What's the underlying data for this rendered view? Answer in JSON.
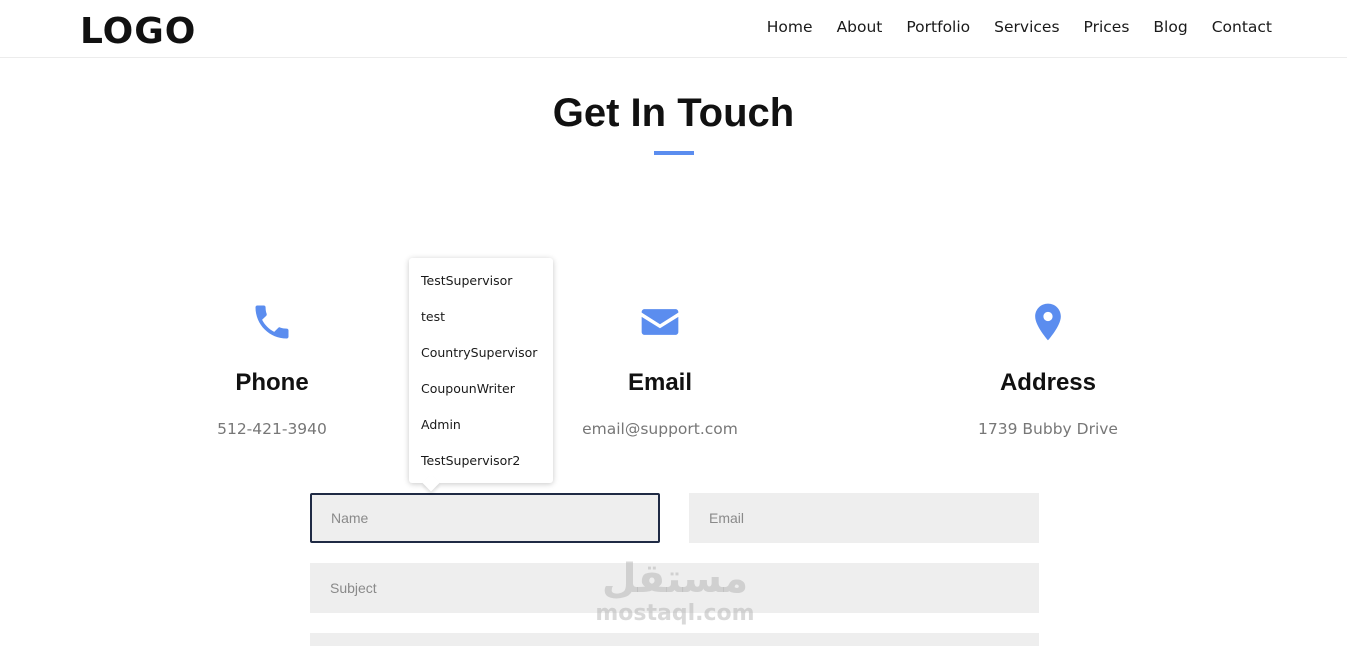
{
  "header": {
    "logo": "LOGO",
    "nav": [
      "Home",
      "About",
      "Portfolio",
      "Services",
      "Prices",
      "Blog",
      "Contact"
    ]
  },
  "section": {
    "title": "Get In Touch"
  },
  "contact_info": {
    "phone": {
      "icon": "phone-icon",
      "heading": "Phone",
      "value": "512-421-3940"
    },
    "email": {
      "icon": "envelope-icon",
      "heading": "Email",
      "value": "email@support.com"
    },
    "address": {
      "icon": "map-pin-icon",
      "heading": "Address",
      "value": "1739 Bubby Drive"
    }
  },
  "form": {
    "name_placeholder": "Name",
    "email_placeholder": "Email",
    "subject_placeholder": "Subject"
  },
  "autocomplete": {
    "options": [
      "TestSupervisor",
      "test",
      "CountrySupervisor",
      "CoupounWriter",
      "Admin",
      "TestSupervisor2"
    ]
  },
  "watermark": {
    "arabic": "مستقل",
    "latin": "mostaql.com"
  },
  "colors": {
    "accent": "#5b8def",
    "field_bg": "#eeeeee",
    "muted_text": "#777777"
  }
}
